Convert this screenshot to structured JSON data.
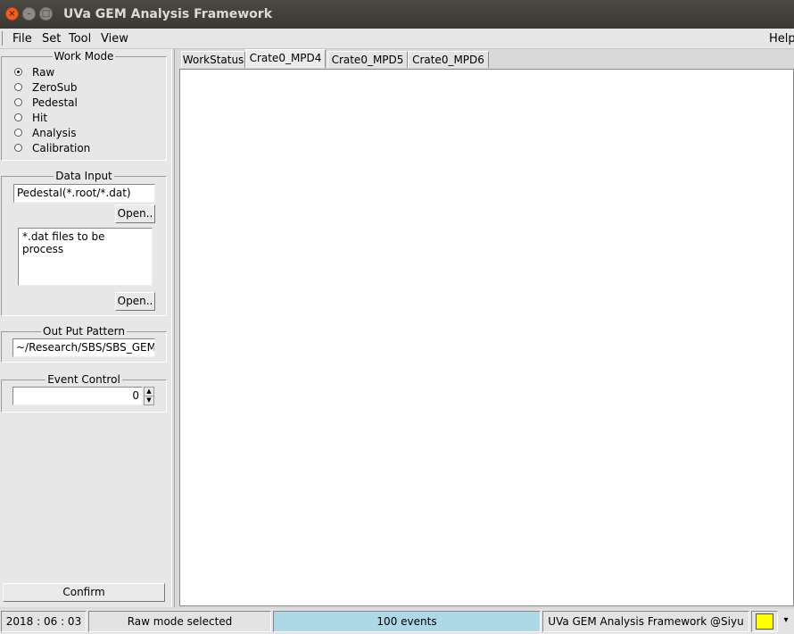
{
  "window": {
    "title": "UVa GEM Analysis Framework",
    "buttons": {
      "close": "×",
      "minimize": "–",
      "maximize": "□"
    }
  },
  "menu": {
    "file": "File",
    "set": "Set",
    "tool": "Tool",
    "view": "View",
    "help": "Help"
  },
  "work_mode": {
    "title": "Work Mode",
    "options": [
      "Raw",
      "ZeroSub",
      "Pedestal",
      "Hit",
      "Analysis",
      "Calibration"
    ],
    "selected": "Raw"
  },
  "data_input": {
    "title": "Data Input",
    "pedestal_value": "Pedestal(*.root/*.dat)",
    "open_label": "Open..",
    "files_placeholder": "*.dat files to be process",
    "open2_label": "Open.."
  },
  "output_pattern": {
    "title": "Out Put Pattern",
    "value": "~/Research/SBS/SBS_GEM"
  },
  "event_control": {
    "title": "Event Control",
    "value": "0",
    "up": "▲",
    "down": "▼"
  },
  "confirm_label": "Confirm",
  "tabs": [
    "WorkStatus",
    "Crate0_MPD4",
    "Crate0_MPD5",
    "Crate0_MPD6"
  ],
  "active_tab": "Crate0_MPD4",
  "status": {
    "date": "2018 : 06 : 03",
    "mode": "Raw mode selected",
    "events": "100 events",
    "credit": "UVa GEM Analysis Framework @Siyu",
    "indicator_color": "#ffff00",
    "dropdown": "▾",
    "events_color": "#add8e6"
  }
}
